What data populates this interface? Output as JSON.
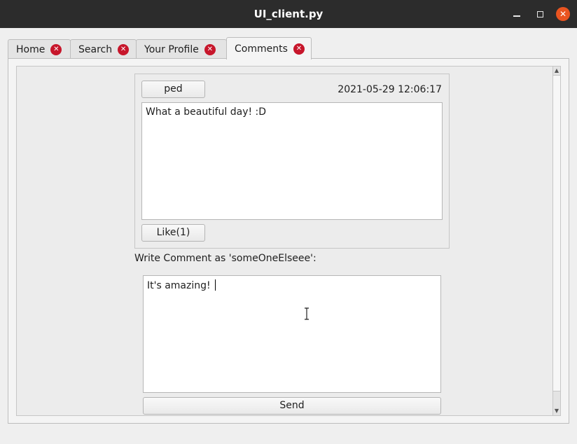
{
  "window": {
    "title": "UI_client.py"
  },
  "tabs": [
    {
      "label": "Home",
      "active": false
    },
    {
      "label": "Search",
      "active": false
    },
    {
      "label": "Your Profile",
      "active": false
    },
    {
      "label": "Comments",
      "active": true
    }
  ],
  "post": {
    "author": "ped",
    "timestamp": "2021-05-29 12:06:17",
    "content": "What a beautiful day! :D",
    "like_label": "Like(1)"
  },
  "comment": {
    "prompt": "Write Comment as 'someOneElseee':",
    "value": "It's amazing! ",
    "send_label": "Send"
  },
  "icons": {
    "tab_close": "close-circle-icon",
    "minimize": "minimize-icon",
    "maximize": "maximize-icon",
    "close": "close-icon"
  },
  "colors": {
    "titlebar": "#2c2c2c",
    "close_button": "#e95420",
    "tab_close": "#c7162b"
  }
}
